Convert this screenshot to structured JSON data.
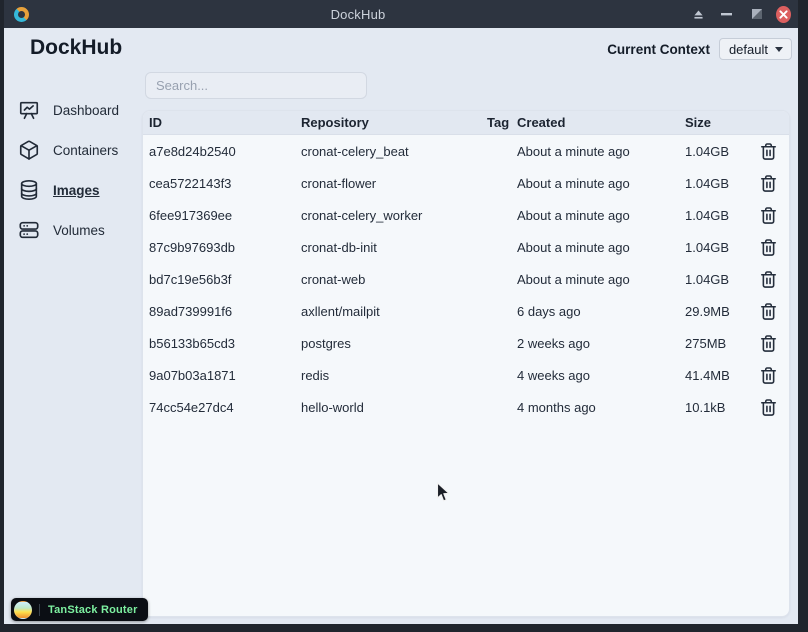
{
  "window": {
    "title": "DockHub",
    "control_icons": [
      "eject-icon",
      "minimize-icon",
      "maximize-icon",
      "close-icon"
    ]
  },
  "header": {
    "app_title": "DockHub",
    "context_label": "Current Context",
    "context_value": "default"
  },
  "sidebar": {
    "items": [
      {
        "label": "Dashboard",
        "icon": "dashboard-chart-icon",
        "active": false
      },
      {
        "label": "Containers",
        "icon": "cube-icon",
        "active": false
      },
      {
        "label": "Images",
        "icon": "database-icon",
        "active": true
      },
      {
        "label": "Volumes",
        "icon": "server-stack-icon",
        "active": false
      }
    ]
  },
  "search": {
    "placeholder": "Search..."
  },
  "table": {
    "columns": [
      "ID",
      "Repository",
      "Tag",
      "Created",
      "Size"
    ],
    "row_action_icon": "trash-icon",
    "rows": [
      {
        "id": "a7e8d24b2540",
        "repository": "cronat-celery_beat",
        "tag": "",
        "created": "About a minute ago",
        "size": "1.04GB"
      },
      {
        "id": "cea5722143f3",
        "repository": "cronat-flower",
        "tag": "",
        "created": "About a minute ago",
        "size": "1.04GB"
      },
      {
        "id": "6fee917369ee",
        "repository": "cronat-celery_worker",
        "tag": "",
        "created": "About a minute ago",
        "size": "1.04GB"
      },
      {
        "id": "87c9b97693db",
        "repository": "cronat-db-init",
        "tag": "",
        "created": "About a minute ago",
        "size": "1.04GB"
      },
      {
        "id": "bd7c19e56b3f",
        "repository": "cronat-web",
        "tag": "",
        "created": "About a minute ago",
        "size": "1.04GB"
      },
      {
        "id": "89ad739991f6",
        "repository": "axllent/mailpit",
        "tag": "",
        "created": "6 days ago",
        "size": "29.9MB"
      },
      {
        "id": "b56133b65cd3",
        "repository": "postgres",
        "tag": "",
        "created": "2 weeks ago",
        "size": "275MB"
      },
      {
        "id": "9a07b03a1871",
        "repository": "redis",
        "tag": "",
        "created": "4 weeks ago",
        "size": "41.4MB"
      },
      {
        "id": "74cc54e27dc4",
        "repository": "hello-world",
        "tag": "",
        "created": "4 months ago",
        "size": "10.1kB"
      }
    ]
  },
  "badge": {
    "label": "TanStack Router",
    "icon": "tanstack-logo"
  },
  "colors": {
    "frame_bg": "#20252d",
    "titlebar_bg": "#2d3440",
    "page_bg": "#e3e9f2",
    "panel_bg": "#f5f8fb",
    "table_header_bg": "#e2e8f1",
    "close_button": "#dc5f5f",
    "badge_bg": "#0b0e14",
    "badge_text": "#7df0a0",
    "text_primary": "#1c2431"
  }
}
